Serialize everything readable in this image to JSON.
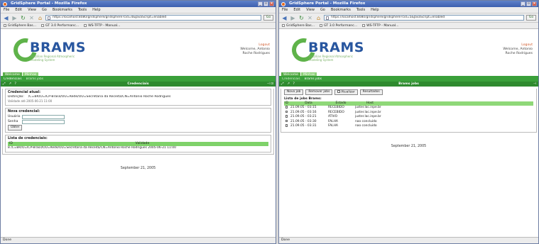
{
  "left": {
    "title": "GridSphere Portal - Mozilla Firefox",
    "menu": [
      "File",
      "Edit",
      "View",
      "Go",
      "Bookmarks",
      "Tools",
      "Help"
    ],
    "url": "https://localhost:8080/gridsphere/gridsphere?cid=4&JavaScript=enabled",
    "go": "Go",
    "bookmarks": [
      "GridSphere Bas...",
      "GT 3.0 Performanc...",
      "WS-TFTP - Manual..."
    ],
    "logo": {
      "name": "BRAMS",
      "sub1": "Brazilian Regional Atmospheric",
      "sub2": "Modeling System"
    },
    "user": {
      "logout": "Logout",
      "welcome": "Welcome, Antonio",
      "name": "Roche Rodrigues"
    },
    "tabs": [
      "Welcome",
      "Minhas"
    ],
    "subtabs": [
      "Credenciais",
      "Brams jobs"
    ],
    "portlet_title": "Credenciais",
    "current_cred": {
      "heading": "Credencial atual:",
      "label": "Distinção:",
      "value": "/C=BR/O=ICP-Brasil/OU=Rede/OU=Secretaria da Receita/CN=Antonio Roche Rodrigues",
      "expires": "Validade até 2005-06-21 11:00"
    },
    "new_cred": {
      "heading": "Nova credencial:",
      "user_label": "Usuário",
      "pass_label": "Senha",
      "button": "Obter"
    },
    "cred_list": {
      "heading": "Lista de credenciais:",
      "col_id": "ID",
      "col_validity": "Validade",
      "row": "8   /C=BR/O=ICP-Brasil/OU=Rede/OU=Secretaria da Receita/CN=Antonio Roche Rodrigues   2005-06-21 11:00"
    },
    "date": "September 21, 2005",
    "status": "Done"
  },
  "right": {
    "title": "GridSphere Portal - Mozilla Firefox",
    "menu": [
      "File",
      "Edit",
      "View",
      "Go",
      "Bookmarks",
      "Tools",
      "Help"
    ],
    "url": "https://localhost:8080/gridsphere/gridsphere?cid=5&JavaScript=enabled",
    "go": "Go",
    "bookmarks": [
      "GridSphere Bas...",
      "GT 3.0 Performanc...",
      "WS-TFTP - Manual..."
    ],
    "logo": {
      "name": "BRAMS",
      "sub1": "Brazilian Regional Atmospheric",
      "sub2": "Modeling System"
    },
    "user": {
      "logout": "Logout",
      "welcome": "Welcome, Antonio",
      "name": "Roche Rodrigues"
    },
    "tabs": [
      "Welcome",
      "Minhas"
    ],
    "subtabs": [
      "Credenciais",
      "Brams jobs"
    ],
    "portlet_title": "Brams jobs",
    "buttons": [
      "Novo job",
      "Remover jobs",
      "Atualizar",
      "Resultados"
    ],
    "autoload": "Auto-refresh",
    "jobs": {
      "heading": "Lista de jobs Brams:",
      "columns": [
        "ID",
        "Data",
        "Estado",
        "Host"
      ],
      "rows": [
        [
          "01",
          "21.09.05 - 03:15",
          "RECEBIDO",
          "juster.lac.inpe.br"
        ],
        [
          "02",
          "21.09.05 - 03:16",
          "RECEBIDO",
          "juster.lac.inpe.br"
        ],
        [
          "03",
          "21.09.05 - 03:21",
          "ATIVO",
          "juster.lac.inpe.br"
        ],
        [
          "04",
          "21.09.05 - 03:30",
          "FALHA",
          "nao concluido"
        ],
        [
          "05",
          "21.09.05 - 03:31",
          "FALHA",
          "nao concluido"
        ]
      ]
    },
    "date": "September 21, 2005",
    "status": "Done"
  }
}
